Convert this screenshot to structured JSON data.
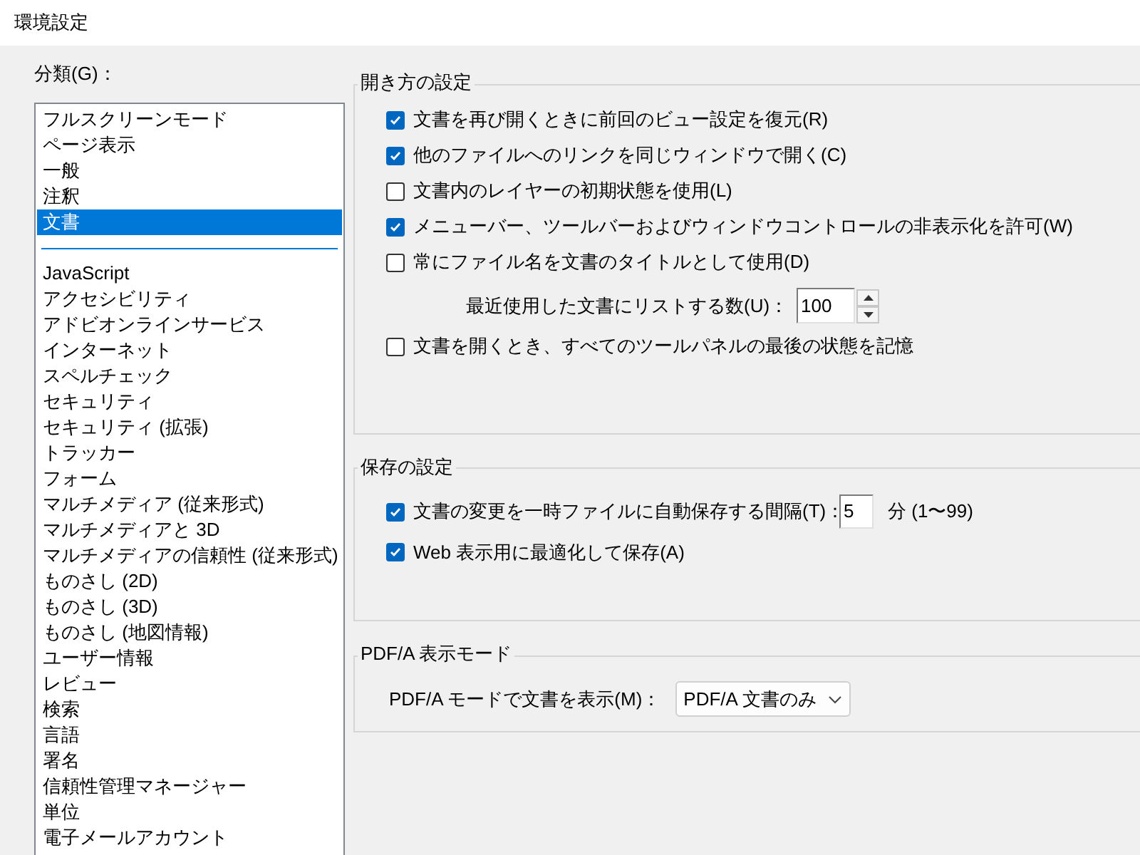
{
  "window": {
    "title": "環境設定"
  },
  "categories": {
    "label": "分類(G)：",
    "pinned_items": [
      {
        "label": "フルスクリーンモード",
        "selected": false
      },
      {
        "label": "ページ表示",
        "selected": false
      },
      {
        "label": "一般",
        "selected": false
      },
      {
        "label": "注釈",
        "selected": false
      },
      {
        "label": "文書",
        "selected": true
      }
    ],
    "items": [
      {
        "label": "JavaScript",
        "selected": false
      },
      {
        "label": "アクセシビリティ",
        "selected": false
      },
      {
        "label": "アドビオンラインサービス",
        "selected": false
      },
      {
        "label": "インターネット",
        "selected": false
      },
      {
        "label": "スペルチェック",
        "selected": false
      },
      {
        "label": "セキュリティ",
        "selected": false
      },
      {
        "label": "セキュリティ (拡張)",
        "selected": false
      },
      {
        "label": "トラッカー",
        "selected": false
      },
      {
        "label": "フォーム",
        "selected": false
      },
      {
        "label": "マルチメディア (従来形式)",
        "selected": false
      },
      {
        "label": "マルチメディアと 3D",
        "selected": false
      },
      {
        "label": "マルチメディアの信頼性 (従来形式)",
        "selected": false
      },
      {
        "label": "ものさし (2D)",
        "selected": false
      },
      {
        "label": "ものさし (3D)",
        "selected": false
      },
      {
        "label": "ものさし (地図情報)",
        "selected": false
      },
      {
        "label": "ユーザー情報",
        "selected": false
      },
      {
        "label": "レビュー",
        "selected": false
      },
      {
        "label": "検索",
        "selected": false
      },
      {
        "label": "言語",
        "selected": false
      },
      {
        "label": "署名",
        "selected": false
      },
      {
        "label": "信頼性管理マネージャー",
        "selected": false
      },
      {
        "label": "単位",
        "selected": false
      },
      {
        "label": "電子メールアカウント",
        "selected": false
      }
    ]
  },
  "groups": [
    {
      "title": "開き方の設定",
      "rows": [
        {
          "kind": "checkbox",
          "label": "文書を再び開くときに前回のビュー設定を復元(R)",
          "checked": true
        },
        {
          "kind": "checkbox",
          "label": "他のファイルへのリンクを同じウィンドウで開く(C)",
          "checked": true
        },
        {
          "kind": "checkbox",
          "label": "文書内のレイヤーの初期状態を使用(L)",
          "checked": false
        },
        {
          "kind": "checkbox",
          "label": "メニューバー、ツールバーおよびウィンドウコントロールの非表示化を許可(W)",
          "checked": true
        },
        {
          "kind": "checkbox",
          "label": "常にファイル名を文書のタイトルとして使用(D)",
          "checked": false
        },
        {
          "kind": "spinner",
          "label": "最近使用した文書にリストする数(U)：",
          "value": "100"
        },
        {
          "kind": "checkbox",
          "label": "文書を開くとき、すべてのツールパネルの最後の状態を記憶",
          "checked": false
        }
      ]
    },
    {
      "title": "保存の設定",
      "rows": [
        {
          "kind": "checkbox_input",
          "label": "文書の変更を一時ファイルに自動保存する間隔(T)：",
          "checked": true,
          "value": "5",
          "suffix": "分 (1〜99)"
        },
        {
          "kind": "checkbox",
          "label": "Web 表示用に最適化して保存(A)",
          "checked": true
        }
      ]
    },
    {
      "title": "PDF/A 表示モード",
      "rows": [
        {
          "kind": "select",
          "label": "PDF/A モードで文書を表示(M)：",
          "value": "PDF/A 文書のみ"
        }
      ]
    }
  ]
}
